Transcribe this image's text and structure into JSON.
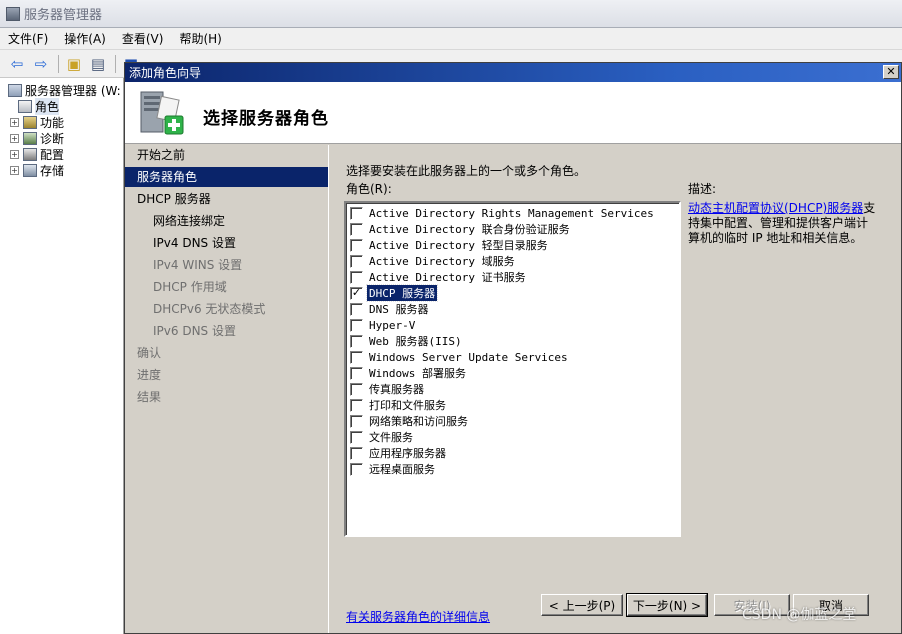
{
  "server_manager": {
    "title": "服务器管理器",
    "menu": [
      "文件(F)",
      "操作(A)",
      "查看(V)",
      "帮助(H)"
    ],
    "tree": {
      "root": "服务器管理器 (W:",
      "items": [
        "角色",
        "功能",
        "诊断",
        "配置",
        "存储"
      ]
    }
  },
  "wizard": {
    "title": "添加角色向导",
    "header_title": "选择服务器角色",
    "nav": [
      {
        "label": "开始之前",
        "state": "done",
        "sub": false
      },
      {
        "label": "服务器角色",
        "state": "current",
        "sub": false
      },
      {
        "label": "DHCP 服务器",
        "state": "done",
        "sub": false
      },
      {
        "label": "网络连接绑定",
        "state": "done",
        "sub": true
      },
      {
        "label": "IPv4 DNS 设置",
        "state": "done",
        "sub": true
      },
      {
        "label": "IPv4 WINS 设置",
        "state": "pending",
        "sub": true
      },
      {
        "label": "DHCP 作用域",
        "state": "pending",
        "sub": true
      },
      {
        "label": "DHCPv6 无状态模式",
        "state": "pending",
        "sub": true
      },
      {
        "label": "IPv6 DNS 设置",
        "state": "pending",
        "sub": true
      },
      {
        "label": "确认",
        "state": "pending",
        "sub": false
      },
      {
        "label": "进度",
        "state": "pending",
        "sub": false
      },
      {
        "label": "结果",
        "state": "pending",
        "sub": false
      }
    ],
    "instruction": "选择要安装在此服务器上的一个或多个角色。",
    "roles_label": "角色(R):",
    "roles": [
      {
        "label": "Active Directory Rights Management Services",
        "checked": false
      },
      {
        "label": "Active Directory 联合身份验证服务",
        "checked": false
      },
      {
        "label": "Active Directory 轻型目录服务",
        "checked": false
      },
      {
        "label": "Active Directory 域服务",
        "checked": false
      },
      {
        "label": "Active Directory 证书服务",
        "checked": false
      },
      {
        "label": "DHCP 服务器",
        "checked": true,
        "selected": true
      },
      {
        "label": "DNS 服务器",
        "checked": false
      },
      {
        "label": "Hyper-V",
        "checked": false
      },
      {
        "label": "Web 服务器(IIS)",
        "checked": false
      },
      {
        "label": "Windows Server Update Services",
        "checked": false
      },
      {
        "label": "Windows 部署服务",
        "checked": false
      },
      {
        "label": "传真服务器",
        "checked": false
      },
      {
        "label": "打印和文件服务",
        "checked": false
      },
      {
        "label": "网络策略和访问服务",
        "checked": false
      },
      {
        "label": "文件服务",
        "checked": false
      },
      {
        "label": "应用程序服务器",
        "checked": false
      },
      {
        "label": "远程桌面服务",
        "checked": false
      }
    ],
    "description": {
      "label": "描述:",
      "link": "动态主机配置协议(DHCP)服务器",
      "text": "支持集中配置、管理和提供客户端计算机的临时 IP 地址和相关信息。"
    },
    "more_info_link": "有关服务器角色的详细信息",
    "buttons": {
      "prev": "< 上一步(P)",
      "next": "下一步(N) >",
      "install": "安装(I)",
      "cancel": "取消"
    }
  },
  "watermark": "CSDN @伽蓝之堂"
}
